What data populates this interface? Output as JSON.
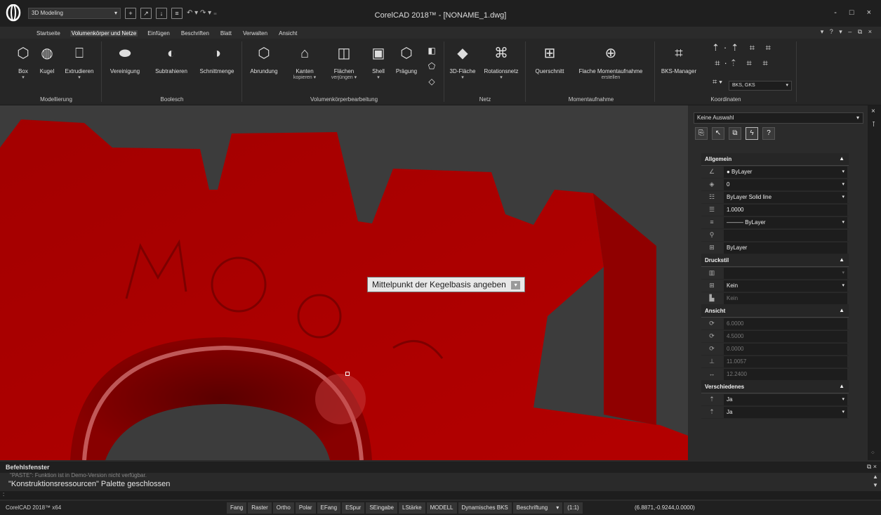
{
  "titlebar": {
    "workspace": "3D Modeling",
    "title": "CorelCAD 2018™ - [NONAME_1.dwg]",
    "qat_icons": [
      "new-file-icon",
      "open-file-icon",
      "save-icon",
      "print-icon"
    ],
    "undo_redo": "↶ ▾ ↷ ▾ ₌",
    "win_controls": [
      "-",
      "□",
      "×"
    ],
    "help": "▾ ? ▾ – ⧉ ×"
  },
  "menu": {
    "tabs": [
      "Startseite",
      "Volumenkörper und Netze",
      "Einfügen",
      "Beschriften",
      "Blatt",
      "Verwalten",
      "Ansicht"
    ],
    "active": "Volumenkörper und Netze"
  },
  "ribbon": {
    "box": "Box",
    "kugel": "Kugel",
    "extrudieren": "Extrudieren",
    "vereinigung": "Vereinigung",
    "subtrahieren": "Subtrahieren",
    "schnittmenge": "Schnittmenge",
    "abrundung": "Abrundung",
    "kanten": "Kanten",
    "kanten_sub": "kopieren ▾",
    "flaechen": "Flächen",
    "flaechen_sub": "verjüngen ▾",
    "shell": "Shell",
    "praegung": "Prägung",
    "flaeche3d": "3D-Fläche",
    "rotationsnetz": "Rotationsnetz",
    "querschnitt": "Querschnitt",
    "flache": "Flache Momentaufnahme",
    "flache_sub": "erstellen",
    "bks_manager": "BKS-Manager",
    "bks_select": "BKS, GKS",
    "groups": {
      "modellierung": "Modellierung",
      "boolesch": "Boolesch",
      "bearbeitung": "Volumenkörperbearbeitung",
      "netz": "Netz",
      "moment": "Momentaufnahme",
      "koordinaten": "Koordinaten"
    }
  },
  "viewport": {
    "tooltip": "Mittelpunkt der Kegelbasis angeben",
    "model_color": "#b00000",
    "background": "#3c3c3c"
  },
  "properties": {
    "selection": "Keine Auswahl",
    "sections": {
      "allgemein": "Allgemein",
      "druckstil": "Druckstil",
      "ansicht": "Ansicht",
      "verschiedenes": "Verschiedenes"
    },
    "allgemein": [
      "● ByLayer",
      "0",
      "ByLayer   Solid line",
      "1.0000",
      "——— ByLayer",
      "",
      "ByLayer"
    ],
    "druckstil": [
      "",
      "Kein",
      "Kein"
    ],
    "ansicht": [
      "6.0000",
      "4.5000",
      "0.0000",
      "11.0057",
      "12.2400"
    ],
    "verschiedenes": [
      "Ja",
      "Ja"
    ]
  },
  "command": {
    "title": "Befehlsfenster",
    "line1": "\"PASTE\": Funktion ist in Demo-Version nicht verfügbar.",
    "line2": "\"Konstruktionsressourcen\" Palette geschlossen",
    "prompt": ":"
  },
  "status": {
    "app": "CorelCAD 2018™ x64",
    "buttons": [
      "Fang",
      "Raster",
      "Ortho",
      "Polar",
      "EFang",
      "ESpur",
      "SEingabe",
      "LStärke",
      "MODELL",
      "Dynamisches BKS"
    ],
    "annotation": "Beschriftung",
    "scale": "(1:1)",
    "coords": "(6.8871,-0.9244,0.0000)"
  }
}
